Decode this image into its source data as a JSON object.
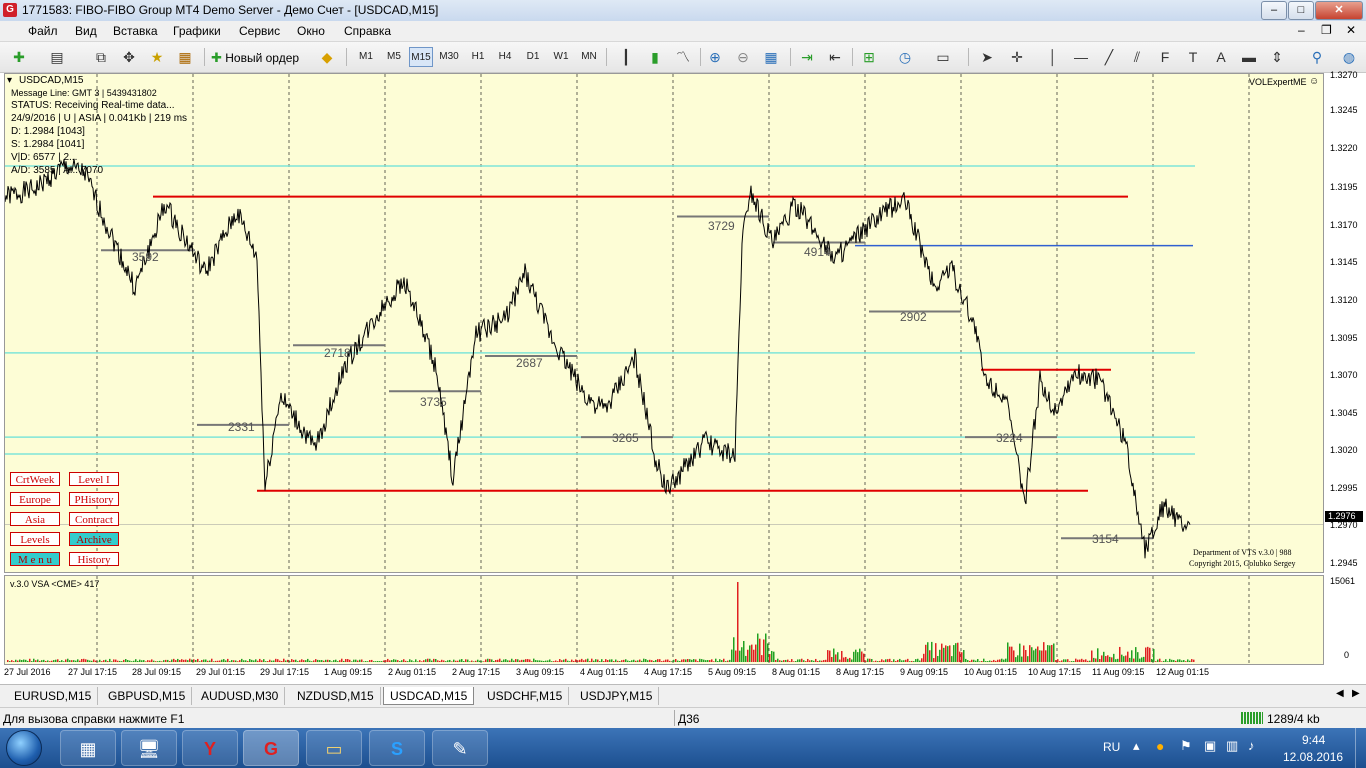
{
  "window": {
    "title": "1771583: FIBO-FIBO Group MT4 Demo Server - Демо Счет - [USDCAD,M15]",
    "logo": "G"
  },
  "menu": [
    "Файл",
    "Вид",
    "Вставка",
    "Графики",
    "Сервис",
    "Окно",
    "Справка"
  ],
  "toolbar": {
    "new_order_label": "Новый ордер",
    "timeframes": [
      "M1",
      "M5",
      "M15",
      "M30",
      "H1",
      "H4",
      "D1",
      "W1",
      "MN"
    ],
    "active_timeframe": "M15"
  },
  "chart": {
    "symbol_label": "USDCAD,M15",
    "info_lines": [
      "Message Line: GMT 3 | 5439431802",
      "STATUS:  Receiving Real-time data...",
      "24/9/2016 | U | ASIA | 0.041Kb | 219 ms",
      "D: 1.2984  [1043]",
      "S: 1.2984  [1041]",
      "V|D: 6577 | 2...",
      "A/D: 3585 | A... 7070"
    ],
    "expert_label": "VOLExpertME",
    "copyright_line1": "Department of VTS  v.3.0 | 988",
    "copyright_line2": "Copyright 2015, Golubko Sergey",
    "current_price": "1.2976",
    "level_labels": [
      "3592",
      "2718",
      "2331",
      "3735",
      "2687",
      "3265",
      "3729",
      "4914",
      "2902",
      "3224",
      "3154"
    ],
    "price_ticks": [
      "1.3270",
      "1.3245",
      "1.3220",
      "1.3195",
      "1.3170",
      "1.3145",
      "1.3120",
      "1.3095",
      "1.3070",
      "1.3045",
      "1.3020",
      "1.2995",
      "1.2970",
      "1.2945"
    ],
    "time_ticks": [
      "27 Jul 2016",
      "27 Jul 17:15",
      "28 Jul 09:15",
      "29 Jul 01:15",
      "29 Jul 17:15",
      "1 Aug 09:15",
      "2 Aug 01:15",
      "2 Aug 17:15",
      "3 Aug 09:15",
      "4 Aug 01:15",
      "4 Aug 17:15",
      "5 Aug 09:15",
      "8 Aug 01:15",
      "8 Aug 17:15",
      "9 Aug 09:15",
      "10 Aug 01:15",
      "10 Aug 17:15",
      "11 Aug 09:15",
      "12 Aug 01:15"
    ],
    "control_buttons": [
      {
        "label": "CrtWeek",
        "active": false
      },
      {
        "label": "Level I",
        "active": false
      },
      {
        "label": "Europe",
        "active": false
      },
      {
        "label": "PHistory",
        "active": false
      },
      {
        "label": "Asia",
        "active": false
      },
      {
        "label": "Contract",
        "active": false
      },
      {
        "label": "Levels",
        "active": false
      },
      {
        "label": "Archive",
        "active": true
      },
      {
        "label": "M e n u",
        "active": true
      },
      {
        "label": "History",
        "active": false
      }
    ],
    "colors": {
      "background": "#fdfdd6",
      "resistance": "#e00000",
      "support_line": "#3060d0",
      "level": "#777777",
      "cyan": "#7fe5d8",
      "price": "#000000"
    }
  },
  "volume": {
    "indicator_label": "v.3.0 VSA <CME> 417",
    "max_label": "15061",
    "min_label": "0"
  },
  "tabs": [
    "EURUSD,M15",
    "GBPUSD,M15",
    "AUDUSD,M30",
    "NZDUSD,M15",
    "USDCAD,M15",
    "USDCHF,M15",
    "USDJPY,M15"
  ],
  "active_tab": "USDCAD,M15",
  "status": {
    "help_text": "Для вызова справки нажмите F1",
    "profile": "Д36",
    "traffic": "1289/4 kb"
  },
  "taskbar": {
    "lang": "RU",
    "time": "9:44",
    "date": "12.08.2016"
  }
}
